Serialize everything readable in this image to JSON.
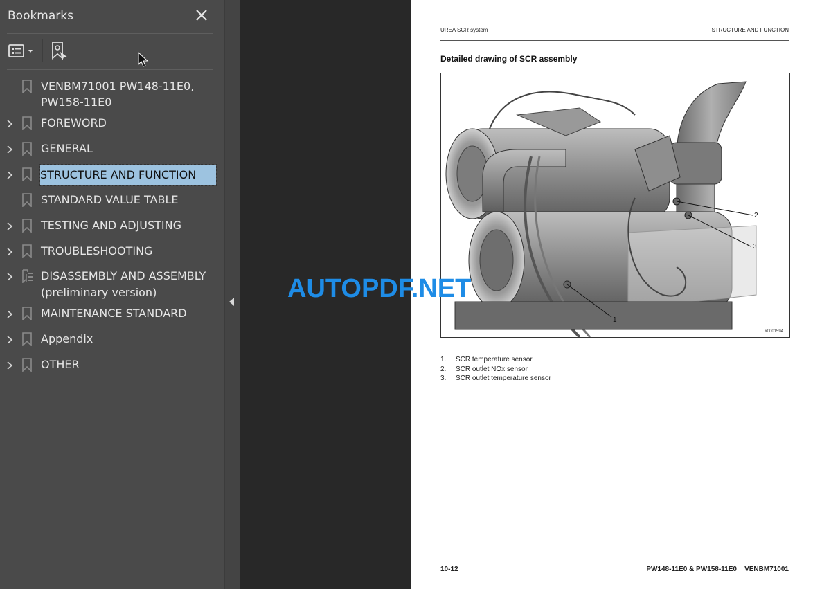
{
  "bookmarks_panel": {
    "title": "Bookmarks",
    "close_icon": "close-icon",
    "toolbar": {
      "options_icon": "list-options-icon",
      "find_icon": "find-current-bookmark-icon"
    },
    "items": [
      {
        "label_line1": "VENBM71001 PW148-11E0,",
        "label_line2": "PW158-11E0",
        "expandable": false,
        "icon": "bookmark-icon",
        "selected": false
      },
      {
        "label": "FOREWORD",
        "expandable": true,
        "icon": "bookmark-icon",
        "selected": false
      },
      {
        "label": "GENERAL",
        "expandable": true,
        "icon": "bookmark-icon",
        "selected": false
      },
      {
        "label": "STRUCTURE AND FUNCTION",
        "expandable": true,
        "icon": "bookmark-icon",
        "selected": true
      },
      {
        "label": "STANDARD VALUE TABLE",
        "expandable": false,
        "icon": "bookmark-icon",
        "selected": false
      },
      {
        "label": "TESTING AND ADJUSTING",
        "expandable": true,
        "icon": "bookmark-icon",
        "selected": false
      },
      {
        "label": "TROUBLESHOOTING",
        "expandable": true,
        "icon": "bookmark-icon",
        "selected": false
      },
      {
        "label_line1": "DISASSEMBLY AND ASSEMBLY",
        "label_line2": "(preliminary version)",
        "expandable": true,
        "icon": "tagged-structure-icon",
        "selected": false
      },
      {
        "label": "MAINTENANCE STANDARD",
        "expandable": true,
        "icon": "bookmark-icon",
        "selected": false
      },
      {
        "label": "Appendix",
        "expandable": true,
        "icon": "bookmark-icon",
        "selected": false
      },
      {
        "label": "OTHER",
        "expandable": true,
        "icon": "bookmark-icon",
        "selected": false
      }
    ],
    "selection_color": "#9dc3e0"
  },
  "document": {
    "header_left": "UREA SCR system",
    "header_right": "STRUCTURE AND FUNCTION",
    "section_title": "Detailed drawing of SCR assembly",
    "figure": {
      "id": "x0001594",
      "callouts": [
        "1",
        "2",
        "3"
      ]
    },
    "legend": [
      {
        "num": "1.",
        "text": "SCR temperature sensor"
      },
      {
        "num": "2.",
        "text": "SCR outlet NOx sensor"
      },
      {
        "num": "3.",
        "text": "SCR outlet temperature sensor"
      }
    ],
    "footer_left": "10-12",
    "footer_right": "PW148-11E0 & PW158-11E0    VENBM71001"
  },
  "watermark": {
    "text": "AUTOPDF.NET",
    "color": "#1e8ce6"
  }
}
